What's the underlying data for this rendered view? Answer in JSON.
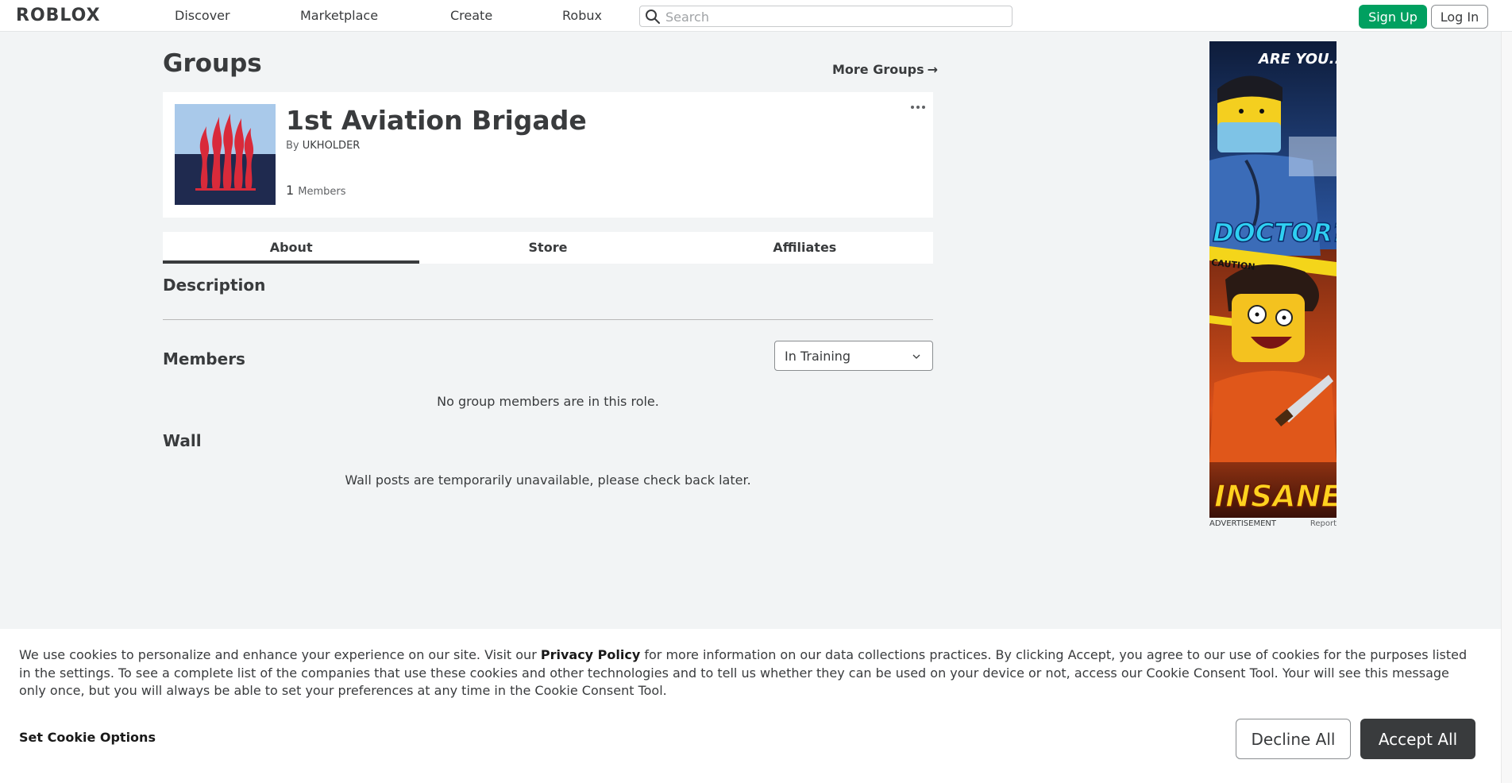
{
  "header": {
    "logo": "RОBLOX",
    "nav": [
      "Discover",
      "Marketplace",
      "Create",
      "Robux"
    ],
    "search_placeholder": "Search",
    "signup_label": "Sign Up",
    "login_label": "Log In"
  },
  "page": {
    "title": "Groups",
    "more_groups": "More Groups",
    "more_groups_arrow": "→"
  },
  "group": {
    "name": "1st Aviation Brigade",
    "by_label": "By",
    "owner": "UKHOLDER",
    "member_count": "1",
    "members_label": "Members"
  },
  "tabs": [
    "About",
    "Store",
    "Affiliates"
  ],
  "sections": {
    "description": "Description",
    "members": "Members",
    "role_selected": "In Training",
    "no_members": "No group members are in this role.",
    "wall": "Wall",
    "wall_unavailable": "Wall posts are temporarily unavailable, please check back later."
  },
  "ad": {
    "top_text": "ARE YOU...",
    "doctor_text": "DOCTOR?",
    "caution_text": "CAUTION",
    "insane_text": "INSANE?",
    "footer_label": "ADVERTISEMENT",
    "report_label": "Report"
  },
  "cookie": {
    "text_before": "We use cookies to personalize and enhance your experience on our site. Visit our ",
    "privacy_policy": "Privacy Policy",
    "text_after": " for more information on our data collections practices. By clicking Accept, you agree to our use of cookies for the purposes listed in the settings. To see a complete list of the companies that use these cookies and other technologies and to tell us whether they can be used on your device or not, access our Cookie Consent Tool. Your will see this message only once, but you will always be able to set your preferences at any time in the Cookie Consent Tool.",
    "set_options": "Set Cookie Options",
    "decline": "Decline All",
    "accept": "Accept All"
  },
  "colors": {
    "brand_green": "#00a060",
    "text_dark": "#393b3d",
    "background": "#f2f4f5"
  }
}
